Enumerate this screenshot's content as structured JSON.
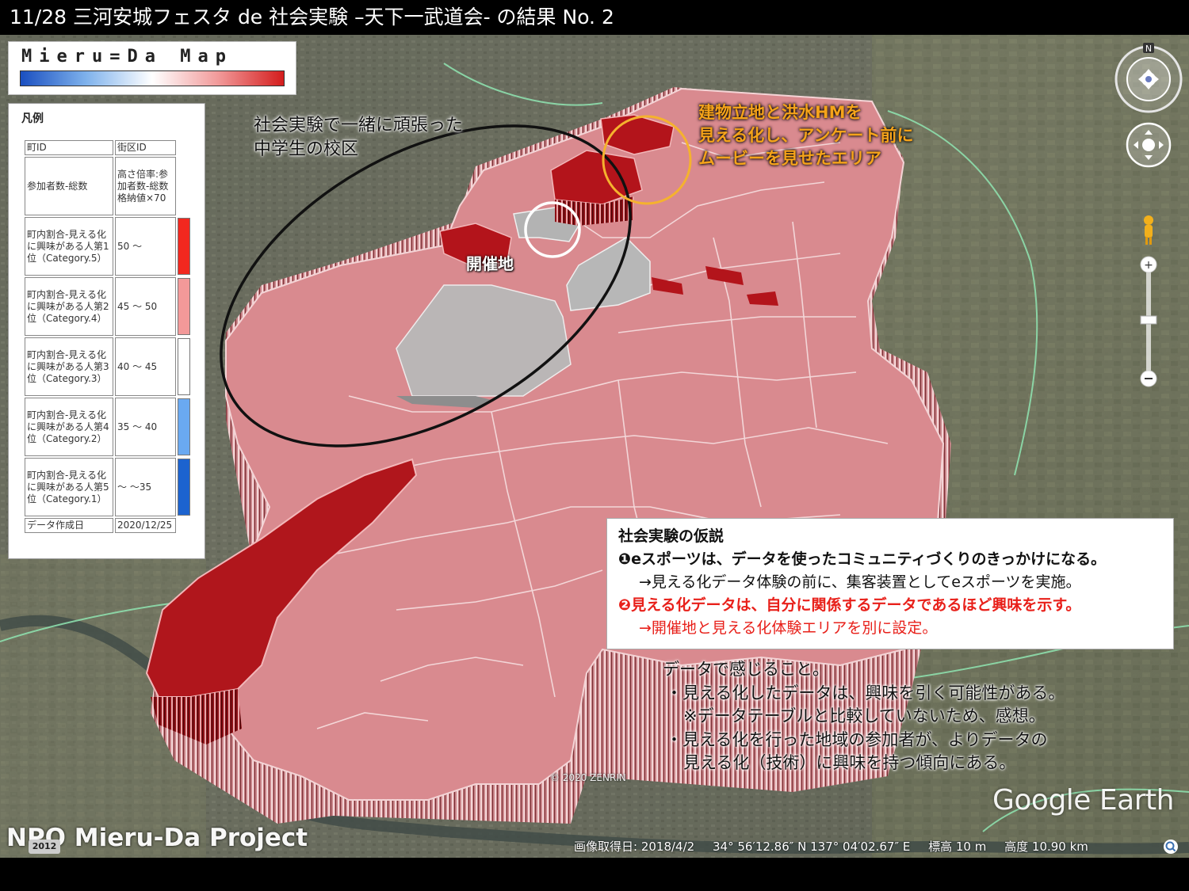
{
  "title": "11/28 三河安城フェスタ de 社会実験 –天下一武道会- の結果 No. 2",
  "logo": {
    "text": "Mieru=Da Map",
    "gradient": [
      "#1a4fc0",
      "#7fb2ec",
      "#ffffff",
      "#f19a9a",
      "#d41d1d"
    ]
  },
  "legend": {
    "title": "凡例",
    "rows": [
      {
        "label": "町ID",
        "value": "街区ID",
        "swatch": null
      },
      {
        "label": "参加者数-総数",
        "value": "高さ倍率:参加者数-総数格納値×70",
        "swatch": null
      },
      {
        "label": "町内割合-見える化に興味がある人第1位（Category.5）",
        "value": "50 ～",
        "swatch": "#f2281f"
      },
      {
        "label": "町内割合-見える化に興味がある人第2位（Category.4）",
        "value": "45 ～ 50",
        "swatch": "#f39999"
      },
      {
        "label": "町内割合-見える化に興味がある人第3位（Category.3）",
        "value": "40 ～ 45",
        "swatch": "#ffffff"
      },
      {
        "label": "町内割合-見える化に興味がある人第4位（Category.2）",
        "value": "35 ～ 40",
        "swatch": "#6aa9f1"
      },
      {
        "label": "町内割合-見える化に興味がある人第5位（Category.1）",
        "value": "～ ～35",
        "swatch": "#1c63cf"
      },
      {
        "label": "データ作成日",
        "value": "2020/12/25",
        "swatch": null
      }
    ]
  },
  "annotations": {
    "school_line1": "社会実験で一緒に頑張った",
    "school_line2": "中学生の校区",
    "venue": "開催地",
    "orange_line1": "建物立地と洪水HMを",
    "orange_line2": "見える化し、アンケート前に",
    "orange_line3": "ムービーを見せたエリア"
  },
  "hypothesis": {
    "heading": "社会実験の仮説",
    "item1": "❶eスポーツは、データを使ったコミュニティづくりのきっかけになる。",
    "item1_sub": "→見える化データ体験の前に、集客装置としてeスポーツを実施。",
    "item2": "❷見える化データは、自分に関係するデータであるほど興味を示す。",
    "item2_sub": "→開催地と見える化体験エリアを別に設定。",
    "red": "#e8201a"
  },
  "findings": {
    "heading": "データで感じること。",
    "line1": "・見える化したデータは、興味を引く可能性がある。",
    "line2": "※データテーブルと比較していないため、感想。",
    "line3": "・見える化を行った地域の参加者が、よりデータの",
    "line4": "見える化（技術）に興味を持つ傾向にある。"
  },
  "map_labels": {
    "copyright": "© 2020 ZENRIN",
    "google_earth": "Google Earth",
    "npo": "NPO Mieru-Da Project",
    "year_badge": "2012",
    "compass_n": "N"
  },
  "statusbar": {
    "imagery_date": "画像取得日: 2018/4/2",
    "coordinates": "34° 56′12.86″ N  137° 04′02.67″ E",
    "elevation": "標高     10 m",
    "altitude": "高度  10.90 km"
  },
  "colors": {
    "school_ellipse": "#111111",
    "orange_circle": "#f5b22e",
    "venue_circle": "#ffffff",
    "region_pink": "#d98a8f",
    "region_dark_red": "#b0161c",
    "region_grey": "#b9b9b9",
    "boundary_green": "#8fe5b2"
  }
}
